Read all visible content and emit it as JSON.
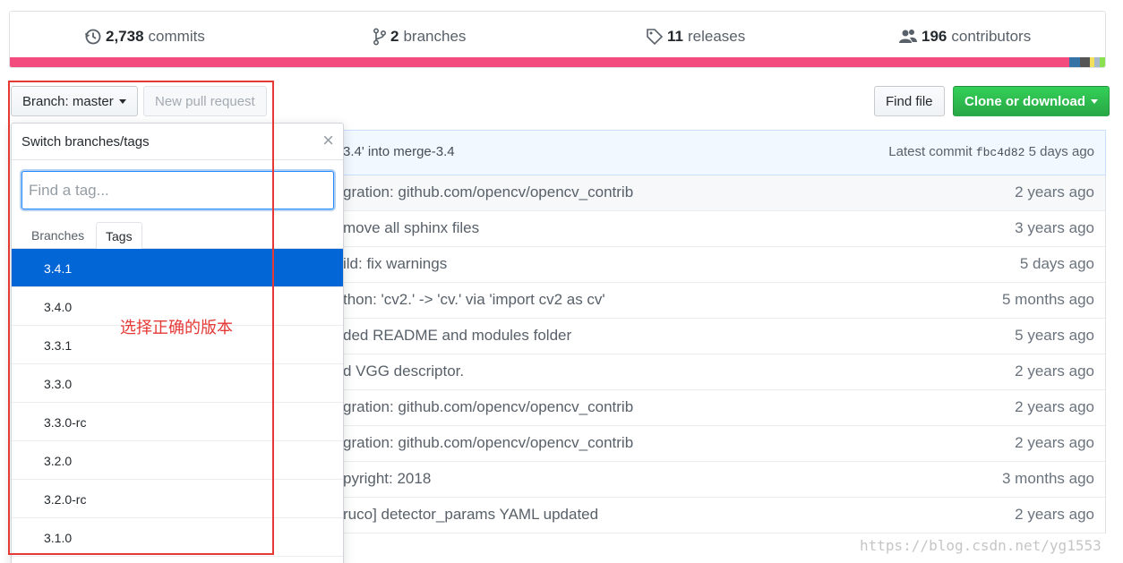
{
  "summary": {
    "commits": {
      "count": "2,738",
      "label": "commits"
    },
    "branches": {
      "count": "2",
      "label": "branches"
    },
    "releases": {
      "count": "11",
      "label": "releases"
    },
    "contributors": {
      "count": "196",
      "label": "contributors"
    },
    "language_colors": [
      "#f34b7d",
      "#3572a5",
      "#555555",
      "#f1e05a",
      "#a8b9cc",
      "#89e051"
    ]
  },
  "toolbar": {
    "branch_label": "Branch: master",
    "new_pr_label": "New pull request",
    "find_file_label": "Find file",
    "clone_label": "Clone or download"
  },
  "commit_tease": {
    "message": "3.4' into merge-3.4",
    "latest_label": "Latest commit",
    "sha": "fbc4d82",
    "age": "5 days ago"
  },
  "files": [
    {
      "message": "gration: github.com/opencv/opencv_contrib",
      "age": "2 years ago"
    },
    {
      "message": "move all sphinx files",
      "age": "3 years ago"
    },
    {
      "message": "ild: fix warnings",
      "age": "5 days ago"
    },
    {
      "message": "thon: 'cv2.' -> 'cv.' via 'import cv2 as cv'",
      "age": "5 months ago"
    },
    {
      "message": "ded README and modules folder",
      "age": "5 years ago"
    },
    {
      "message": "d VGG descriptor.",
      "age": "2 years ago"
    },
    {
      "message": "gration: github.com/opencv/opencv_contrib",
      "age": "2 years ago"
    },
    {
      "message": "gration: github.com/opencv/opencv_contrib",
      "age": "2 years ago"
    },
    {
      "message": "pyright: 2018",
      "age": "3 months ago"
    },
    {
      "message": "ruco] detector_params YAML updated",
      "age": "2 years ago"
    }
  ],
  "dropdown": {
    "title": "Switch branches/tags",
    "close_glyph": "×",
    "filter_placeholder": "Find a tag...",
    "tabs": [
      "Branches",
      "Tags"
    ],
    "selected_tab": "Tags",
    "tags": [
      "3.4.1",
      "3.4.0",
      "3.3.1",
      "3.3.0",
      "3.3.0-rc",
      "3.2.0",
      "3.2.0-rc",
      "3.1.0"
    ],
    "selected_tag": "3.4.1"
  },
  "annotation": {
    "note": "选择正确的版本",
    "color": "#e53935"
  },
  "watermark": "https://blog.csdn.net/yg1553"
}
